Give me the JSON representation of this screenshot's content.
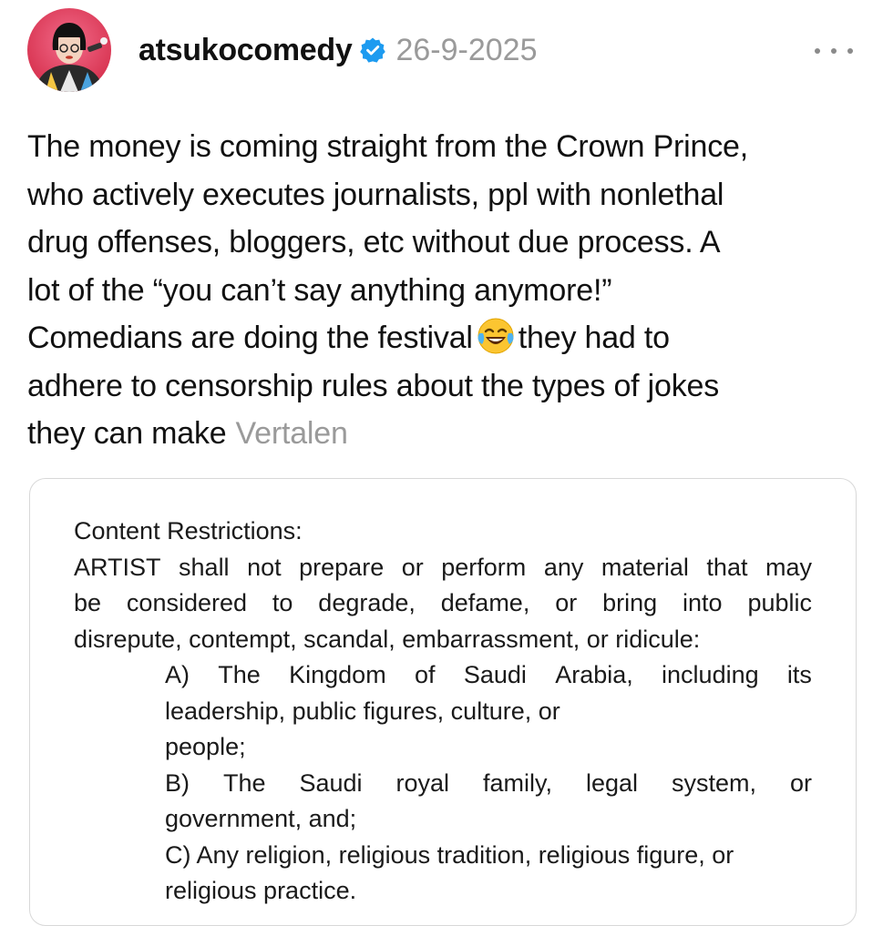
{
  "post": {
    "username": "atsukocomedy",
    "verified_icon": "verified-badge-icon",
    "date": "26-9-2025",
    "more_icon": "more-options-icon",
    "text_lines": [
      "The money is coming straight from the Crown Prince,",
      "who actively executes journalists, ppl with nonlethal",
      "drug offenses, bloggers, etc without due process. A",
      "lot of the “you can’t say anything anymore!”",
      "Comedians are doing the festival",
      "they had to",
      "adhere to censorship rules about the types of jokes",
      "they can make"
    ],
    "emoji_icon": "face-with-tears-of-joy-icon",
    "translate_label": "Vertalen"
  },
  "image": {
    "heading": "Content Restrictions:",
    "paragraph_lines": [
      [
        "ARTIST",
        "shall",
        "not",
        "prepare",
        "or",
        "perform",
        "any",
        "material",
        "that",
        "may"
      ],
      [
        "be",
        "considered",
        "to",
        "degrade,",
        "defame,",
        "or",
        "bring",
        "into",
        "public"
      ],
      "disrepute, contempt, scandal, embarrassment, or ridicule:"
    ],
    "item_a": [
      [
        "A)",
        "The",
        "Kingdom",
        "of",
        "Saudi",
        "Arabia,",
        "including",
        "its"
      ],
      "leadership, public figures, culture, or",
      "people;"
    ],
    "item_b": [
      [
        "B)",
        "The",
        "Saudi",
        "royal",
        "family,",
        "legal",
        "system,",
        "or"
      ],
      "government, and;"
    ],
    "item_c": [
      "C) Any religion, religious tradition, religious figure, or",
      "religious practice."
    ]
  },
  "colors": {
    "text": "#111111",
    "muted": "#9a9a9a",
    "verified": "#1d9bf0",
    "card_border": "#d8d8d8"
  }
}
